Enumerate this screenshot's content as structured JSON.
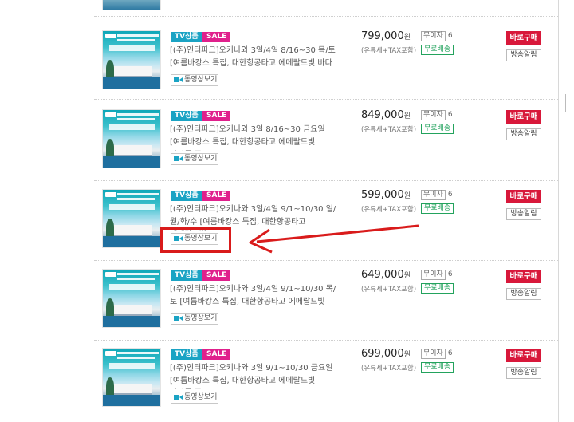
{
  "labels": {
    "tv_badge": "TV상품",
    "sale_badge": "SALE",
    "video_button": "동영상보기",
    "won": "원",
    "tax_note": "(유류세+TAX포함)",
    "interest_free": "무이자",
    "free_shipping": "무료배송",
    "buy_now": "바로구매",
    "broadcast_alert": "방송알림"
  },
  "products": [
    {
      "title": "[(주)인터파크]오키나와 3일/4일 8/16~30 목/토 [여름바캉스 특집, 대한항공타고 에메랄드빛 바다",
      "price": "799,000",
      "installment_months": "6"
    },
    {
      "title": "[(주)인터파크]오키나와 3일 8/16~30 금요일 [여름바캉스 특집, 대한항공타고 에메랄드빛 바다를 즐",
      "price": "849,000",
      "installment_months": "6"
    },
    {
      "title": "[(주)인터파크]오키나와 3일/4일 9/1~10/30 일/월/화/수 [여름바캉스 특집, 대한항공타고 에메랄드빛",
      "price": "599,000",
      "installment_months": "6"
    },
    {
      "title": "[(주)인터파크]오키나와 3일/4일 9/1~10/30 목/토 [여름바캉스 특집, 대한항공타고 에메랄드빛 바다",
      "price": "649,000",
      "installment_months": "6"
    },
    {
      "title": "[(주)인터파크]오키나와 3일 9/1~10/30 금요일 [여름바캉스 특집, 대한항공타고 에메랄드빛 바다를 즐",
      "price": "699,000",
      "installment_months": "6"
    }
  ],
  "colors": {
    "buy_button": "#d8183a",
    "tv_badge": "#1aa3c4",
    "sale_badge": "#e0208c",
    "free_shipping": "#23a35d",
    "annotation": "#d91b1b"
  },
  "annotation": {
    "target": "video-button-row-3",
    "shape": "red box with arrow"
  }
}
